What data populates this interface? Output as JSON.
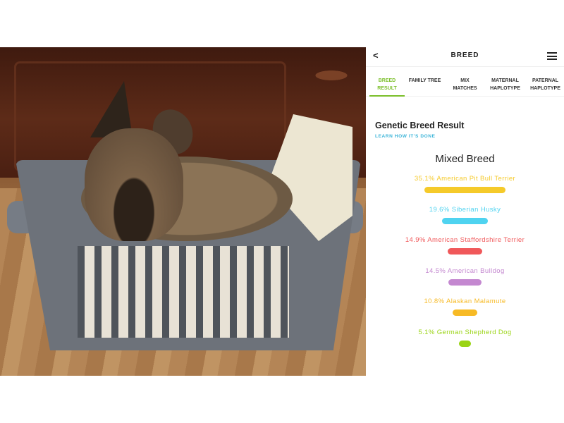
{
  "header": {
    "back_label": "<",
    "title": "BREED",
    "menu_icon": "menu-icon"
  },
  "tabs": [
    {
      "label": "BREED\nRESULT",
      "active": true
    },
    {
      "label": "FAMILY TREE",
      "active": false
    },
    {
      "label": "MIX\nMATCHES",
      "active": false
    },
    {
      "label": "MATERNAL\nHAPLOTYPE",
      "active": false
    },
    {
      "label": "PATERNAL\nHAPLOTYPE",
      "active": false
    }
  ],
  "result": {
    "title": "Genetic Breed Result",
    "learn_link": "LEARN HOW IT'S DONE",
    "mix_label": "Mixed Breed"
  },
  "breeds": [
    {
      "label": "35.1% American Pit Bull Terrier",
      "percent": 35.1,
      "color": "#f5ca2a"
    },
    {
      "label": "19.6% Siberian Husky",
      "percent": 19.6,
      "color": "#4fd3f0"
    },
    {
      "label": "14.9% American Staffordshire Terrier",
      "percent": 14.9,
      "color": "#f0585a"
    },
    {
      "label": "14.5% American Bulldog",
      "percent": 14.5,
      "color": "#c488d0"
    },
    {
      "label": "10.8% Alaskan Malamute",
      "percent": 10.8,
      "color": "#f7ba25"
    },
    {
      "label": "5.1% German Shepherd Dog",
      "percent": 5.1,
      "color": "#9ad414"
    }
  ],
  "colors": {
    "accent": "#7bbf2a",
    "link": "#3bb4d8"
  }
}
